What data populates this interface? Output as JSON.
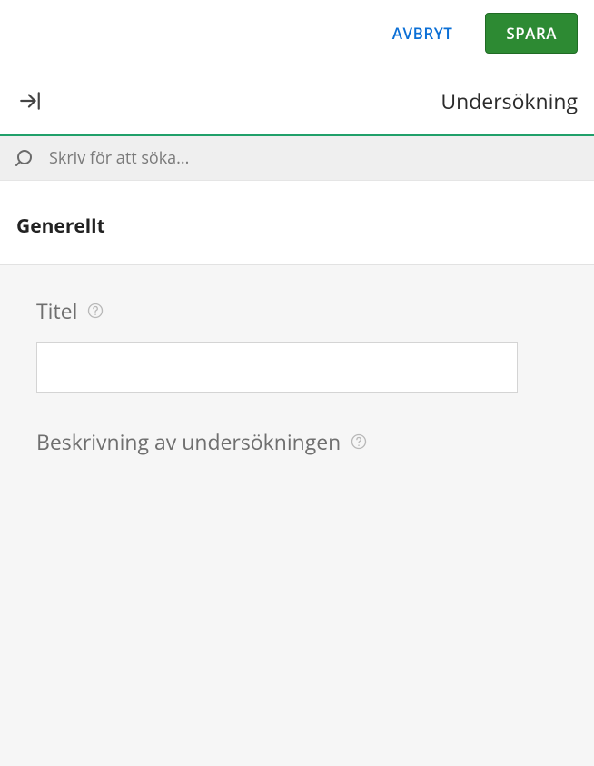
{
  "actions": {
    "cancel_label": "AVBRYT",
    "save_label": "SPARA"
  },
  "header": {
    "title": "Undersökning"
  },
  "search": {
    "placeholder": "Skriv för att söka..."
  },
  "section": {
    "heading": "Generellt"
  },
  "fields": {
    "title": {
      "label": "Titel",
      "value": ""
    },
    "description": {
      "label": "Beskrivning av undersökningen"
    }
  },
  "colors": {
    "accent": "#20a06a",
    "primary_button": "#2d8a33",
    "link": "#0b6fd6"
  }
}
